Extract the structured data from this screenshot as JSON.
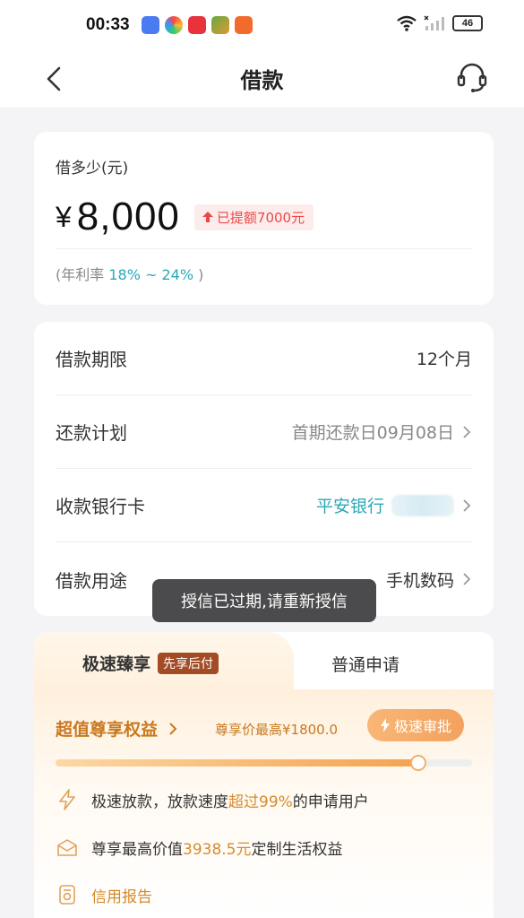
{
  "status_bar": {
    "time": "00:33",
    "battery": "46"
  },
  "nav": {
    "title": "借款"
  },
  "amount": {
    "label": "借多少(元)",
    "currency": "¥",
    "value": "8,000",
    "raise_badge": "已提额7000元",
    "rate_prefix": "(年利率 ",
    "rate_value": "18% ~ 24%",
    "rate_suffix": " )"
  },
  "details": [
    {
      "label": "借款期限",
      "value": "12个月"
    },
    {
      "label": "还款计划",
      "value": "首期还款日09月08日"
    },
    {
      "label": "收款银行卡",
      "value": "平安银行"
    },
    {
      "label": "借款用途",
      "value": "手机数码"
    }
  ],
  "toast": "授信已过期,请重新授信",
  "tabs": {
    "fast_label": "极速臻享",
    "fast_badge": "先享后付",
    "normal_label": "普通申请"
  },
  "benefits": {
    "title": "超值尊享权益",
    "price": "尊享价最高¥1800.0",
    "fast_button": "极速审批",
    "progress": 0.87,
    "item1_a": "极速放款，放款速度",
    "item1_b": "超过99%",
    "item1_c": "的申请用户",
    "item2_a": "尊享最高价值",
    "item2_b": "3938.5元",
    "item2_c": "定制生活权益",
    "item3": "信用报告"
  },
  "colors": {
    "accent_teal": "#2aa8b8",
    "accent_orange": "#c9791f",
    "badge_red": "#e84a4a"
  }
}
